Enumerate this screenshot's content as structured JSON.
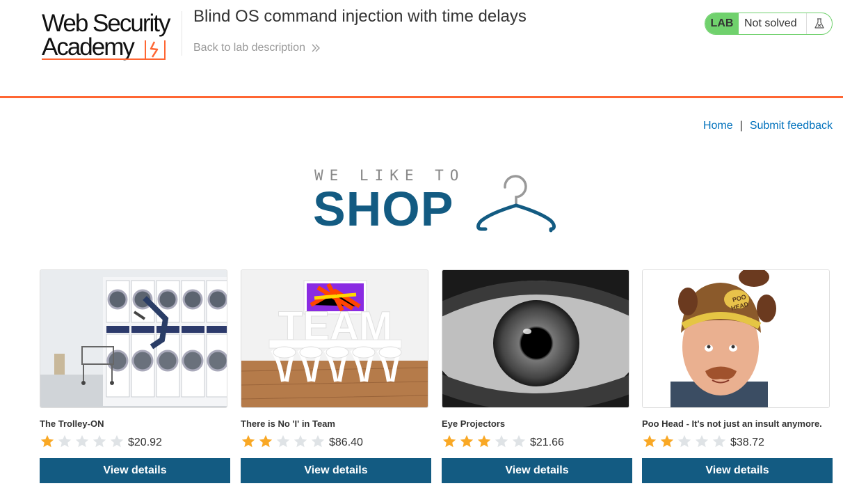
{
  "header": {
    "logo_line1": "Web Security",
    "logo_line2": "Academy",
    "lab_title": "Blind OS command injection with time delays",
    "back_link": "Back to lab description",
    "status_label": "LAB",
    "status_text": "Not solved"
  },
  "nav": {
    "home": "Home",
    "separator": "|",
    "feedback": "Submit feedback"
  },
  "banner": {
    "small": "WE LIKE TO",
    "big": "SHOP"
  },
  "products": [
    {
      "name": "The Trolley-ON",
      "rating": 1,
      "price": "$20.92",
      "button": "View details",
      "image": "laundromat-photo"
    },
    {
      "name": "There is No 'I' in Team",
      "rating": 2,
      "price": "$86.40",
      "button": "View details",
      "image": "team-room-photo"
    },
    {
      "name": "Eye Projectors",
      "rating": 3,
      "price": "$21.66",
      "button": "View details",
      "image": "eye-closeup-photo"
    },
    {
      "name": "Poo Head - It's not just an insult anymore.",
      "rating": 2,
      "price": "$38.72",
      "button": "View details",
      "image": "poo-head-photo"
    }
  ],
  "colors": {
    "accent": "#ff6633",
    "primary": "#135b82",
    "link": "#0071bc",
    "status_green": "#70d16d",
    "star_filled": "#f9a825",
    "star_empty": "#dfe3e6"
  }
}
